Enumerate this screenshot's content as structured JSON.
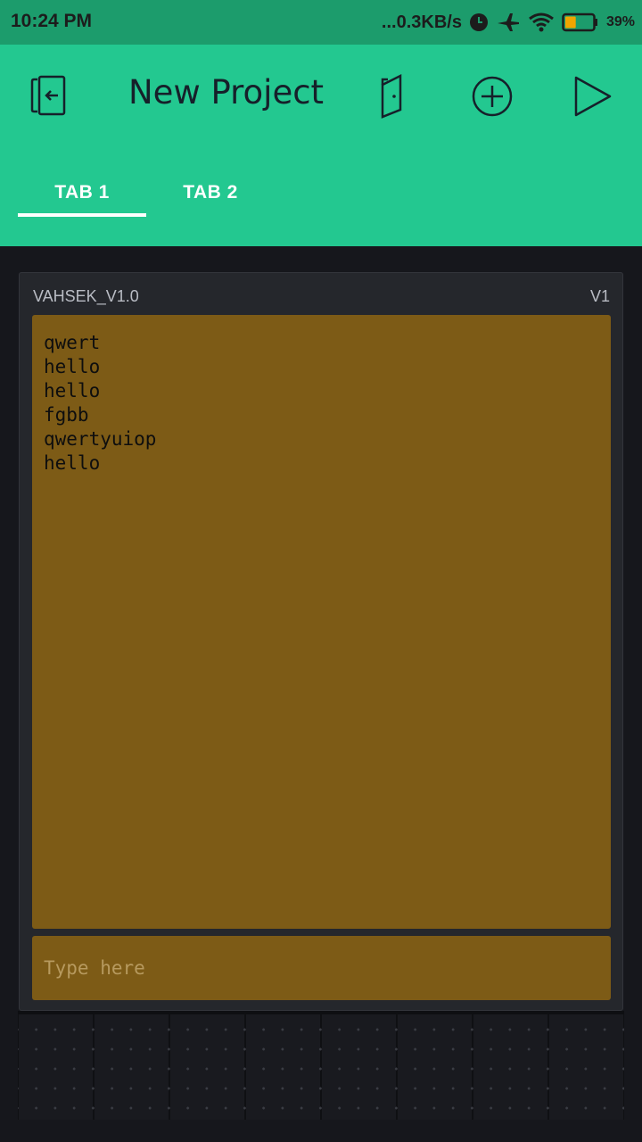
{
  "status_bar": {
    "time": "10:24 PM",
    "network_speed": "...0.3KB/s",
    "battery_percent": "39%",
    "icons": [
      "alarm-icon",
      "airplane-icon",
      "wifi-icon",
      "battery-icon"
    ],
    "battery_level": 0.39,
    "battery_color": "#f0a500"
  },
  "app_bar": {
    "title": "New Project",
    "background": "#23c890",
    "actions": [
      "exit-icon",
      "device-icon",
      "add-icon",
      "play-icon"
    ]
  },
  "tabs": [
    {
      "label": "TAB 1",
      "active": true
    },
    {
      "label": "TAB 2",
      "active": false
    }
  ],
  "terminal_widget": {
    "name": "VAHSEK_V1.0",
    "pin": "V1",
    "background": "#7d5b16",
    "lines": [
      "qwert",
      "hello",
      "hello",
      "fgbb",
      "qwertyuiop",
      "hello"
    ],
    "input_placeholder": "Type here",
    "input_value": ""
  }
}
